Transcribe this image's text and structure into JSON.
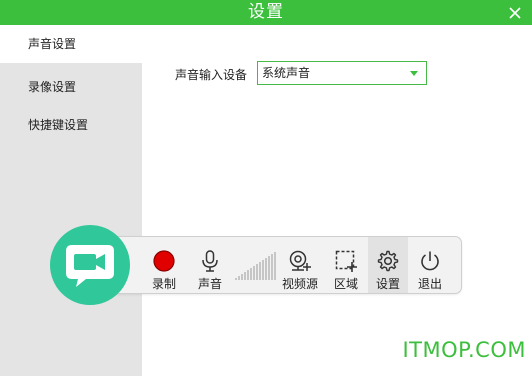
{
  "window": {
    "title": "设置"
  },
  "sidebar": {
    "items": [
      {
        "label": "声音设置"
      },
      {
        "label": "录像设置"
      },
      {
        "label": "快捷键设置"
      }
    ]
  },
  "audio_settings": {
    "input_device_label": "声音输入设备",
    "input_device_value": "系统声音"
  },
  "toolbar": {
    "record_label": "录制",
    "sound_label": "声音",
    "video_source_label": "视频源",
    "region_label": "区域",
    "settings_label": "设置",
    "exit_label": "退出"
  },
  "watermark": "ITMOP.COM",
  "colors": {
    "accent": "#3cbf3c",
    "record_red": "#e00000",
    "camera_circle": "#30c79a"
  }
}
